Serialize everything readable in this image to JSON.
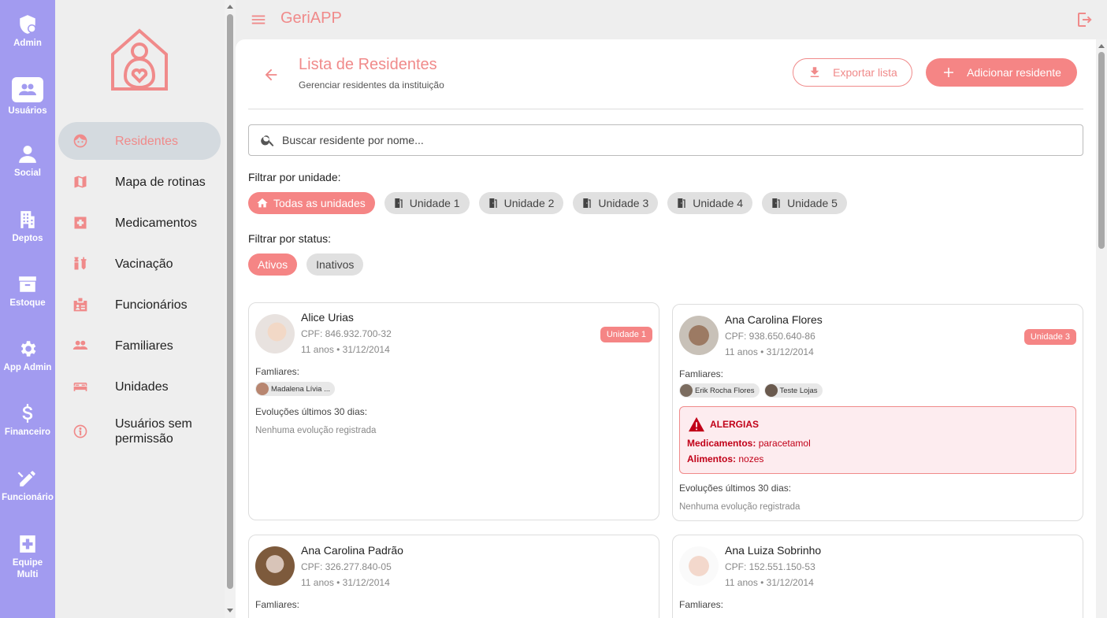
{
  "rail": [
    {
      "label": "Admin",
      "icon": "shield-admin-icon",
      "active": false
    },
    {
      "label": "Usuários",
      "icon": "users-group-icon",
      "active": true
    },
    {
      "label": "Social",
      "icon": "person-icon",
      "active": false
    },
    {
      "label": "Deptos",
      "icon": "building-icon",
      "active": false
    },
    {
      "label": "Estoque",
      "icon": "archive-box-icon",
      "active": false
    },
    {
      "label": "App Admin",
      "icon": "gear-icon",
      "active": false
    },
    {
      "label": "Financeiro",
      "icon": "dollar-icon",
      "active": false
    },
    {
      "label": "Funcionário",
      "icon": "edit-pen-icon",
      "active": false
    },
    {
      "label": "Equipe Multi",
      "icon": "medical-plus-icon",
      "active": false
    }
  ],
  "sidebar": {
    "items": [
      {
        "label": "Residentes",
        "icon": "face-icon",
        "active": true
      },
      {
        "label": "Mapa de rotinas",
        "icon": "map-icon"
      },
      {
        "label": "Medicamentos",
        "icon": "medical-plus-icon"
      },
      {
        "label": "Vacinação",
        "icon": "vaccine-icon"
      },
      {
        "label": "Funcionários",
        "icon": "badge-icon"
      },
      {
        "label": "Familiares",
        "icon": "people-icon"
      },
      {
        "label": "Unidades",
        "icon": "bed-icon"
      },
      {
        "label": "Usuários sem permissão",
        "icon": "info-person-icon"
      }
    ]
  },
  "topbar": {
    "title": "GeriAPP"
  },
  "header": {
    "title": "Lista de Residentes",
    "subtitle": "Gerenciar residentes da instituição",
    "export_label": "Exportar lista",
    "add_label": "Adicionar residente"
  },
  "search": {
    "placeholder": "Buscar residente por nome..."
  },
  "filters": {
    "unit_label": "Filtrar por unidade:",
    "units": [
      "Todas as unidades",
      "Unidade 1",
      "Unidade 2",
      "Unidade 3",
      "Unidade 4",
      "Unidade 5"
    ],
    "status_label": "Filtrar por status:",
    "statuses": [
      "Ativos",
      "Inativos"
    ]
  },
  "labels": {
    "families": "Famliares:",
    "evolutions": "Evoluções últimos 30 dias:",
    "no_evolution": "Nenhuma evolução registrada",
    "allergies": "ALERGIAS",
    "meds": "Medicamentos:",
    "foods": "Alimentos:"
  },
  "residents": [
    {
      "name": "Alice Urias",
      "cpf": "CPF: 846.932.700-32",
      "age": "11 anos • 31/12/2014",
      "unit": "Unidade 1",
      "families": [
        "Madalena Lívia ..."
      ]
    },
    {
      "name": "Ana Carolina Flores",
      "cpf": "CPF: 938.650.640-86",
      "age": "11 anos • 31/12/2014",
      "unit": "Unidade 3",
      "families": [
        "Erik Rocha Flores",
        "Teste Lojas"
      ],
      "allergy_meds": "paracetamol",
      "allergy_foods": "nozes"
    },
    {
      "name": "Ana Carolina Padrão",
      "cpf": "CPF: 326.277.840-05",
      "age": "11 anos • 31/12/2014"
    },
    {
      "name": "Ana Luiza Sobrinho",
      "cpf": "CPF: 152.551.150-53",
      "age": "11 anos • 31/12/2014"
    }
  ],
  "colors": {
    "accent": "#f08a8a",
    "rail": "#a29bf0",
    "chip_active": "#f58585"
  }
}
